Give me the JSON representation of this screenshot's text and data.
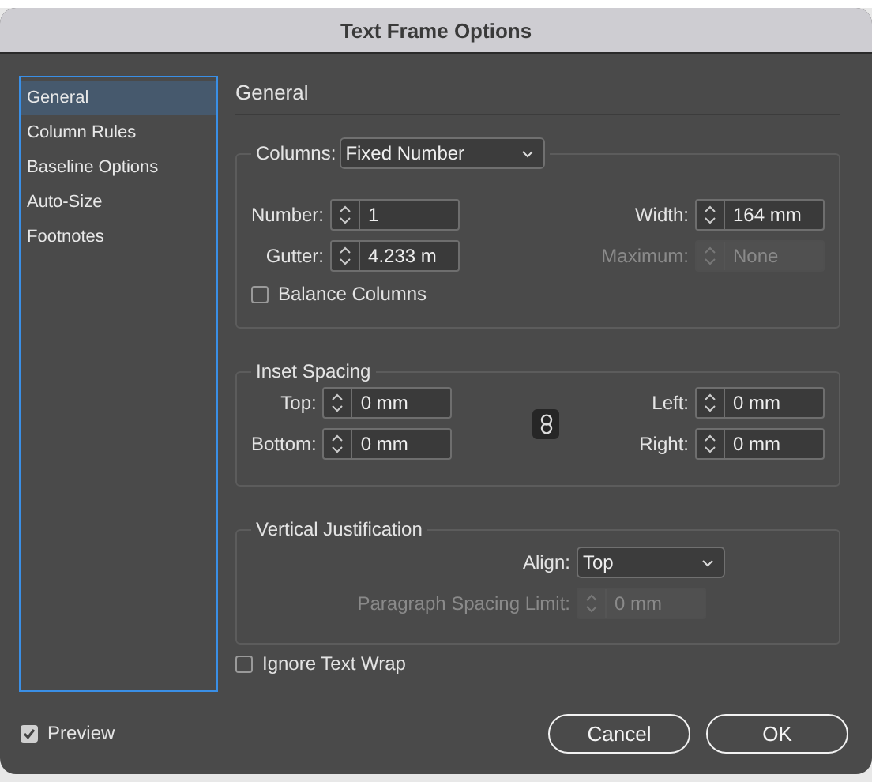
{
  "window": {
    "title": "Text Frame Options"
  },
  "sidebar": {
    "items": [
      {
        "label": "General",
        "selected": true
      },
      {
        "label": "Column Rules",
        "selected": false
      },
      {
        "label": "Baseline Options",
        "selected": false
      },
      {
        "label": "Auto-Size",
        "selected": false
      },
      {
        "label": "Footnotes",
        "selected": false
      }
    ]
  },
  "section_title": "General",
  "columns": {
    "label": "Columns:",
    "dropdown": "Fixed Number",
    "fields_left": [
      {
        "label": "Number:",
        "value": "1",
        "disabled": false
      },
      {
        "label": "Gutter:",
        "value": "4.233 m",
        "disabled": false
      }
    ],
    "fields_right": [
      {
        "label": "Width:",
        "value": "164 mm",
        "disabled": false
      },
      {
        "label": "Maximum:",
        "value": "None",
        "disabled": true
      }
    ],
    "balance": {
      "label": "Balance Columns",
      "checked": false
    }
  },
  "inset_spacing": {
    "title": "Inset Spacing",
    "linked": true,
    "fields_left": [
      {
        "label": "Top:",
        "value": "0 mm",
        "disabled": false
      },
      {
        "label": "Bottom:",
        "value": "0 mm",
        "disabled": false
      }
    ],
    "fields_right": [
      {
        "label": "Left:",
        "value": "0 mm",
        "disabled": false
      },
      {
        "label": "Right:",
        "value": "0 mm",
        "disabled": false
      }
    ]
  },
  "vertical_justification": {
    "title": "Vertical Justification",
    "align": {
      "label": "Align:",
      "value": "Top"
    },
    "spacing_limit": {
      "label": "Paragraph Spacing Limit:",
      "value": "0 mm",
      "disabled": true
    }
  },
  "ignore_text_wrap": {
    "label": "Ignore Text Wrap",
    "checked": false
  },
  "preview": {
    "label": "Preview",
    "checked": true
  },
  "buttons": [
    "Cancel",
    "OK"
  ]
}
